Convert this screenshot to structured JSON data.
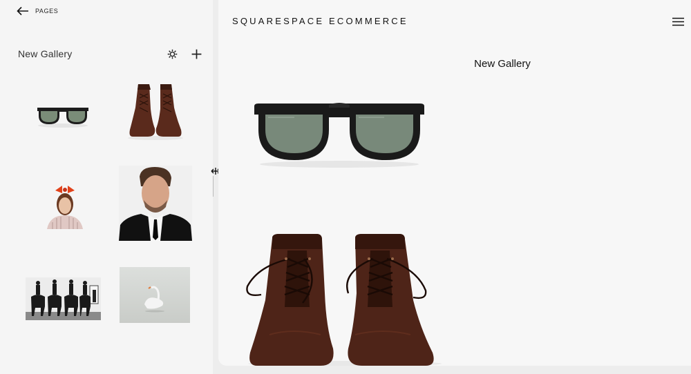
{
  "nav": {
    "back_label": "PAGES"
  },
  "panel": {
    "title": "New Gallery"
  },
  "thumbnails": [
    {
      "name": "sunglasses"
    },
    {
      "name": "leather-boots"
    },
    {
      "name": "girl-with-bow"
    },
    {
      "name": "man-in-suit"
    },
    {
      "name": "horse-riders"
    },
    {
      "name": "swan"
    }
  ],
  "preview": {
    "site_title": "SQUARESPACE ECOMMERCE",
    "gallery_title": "New Gallery"
  },
  "icons": {
    "back": "arrow-left-icon",
    "settings": "gear-icon",
    "add": "plus-icon",
    "menu": "hamburger-icon",
    "resize": "move-cursor-icon"
  }
}
